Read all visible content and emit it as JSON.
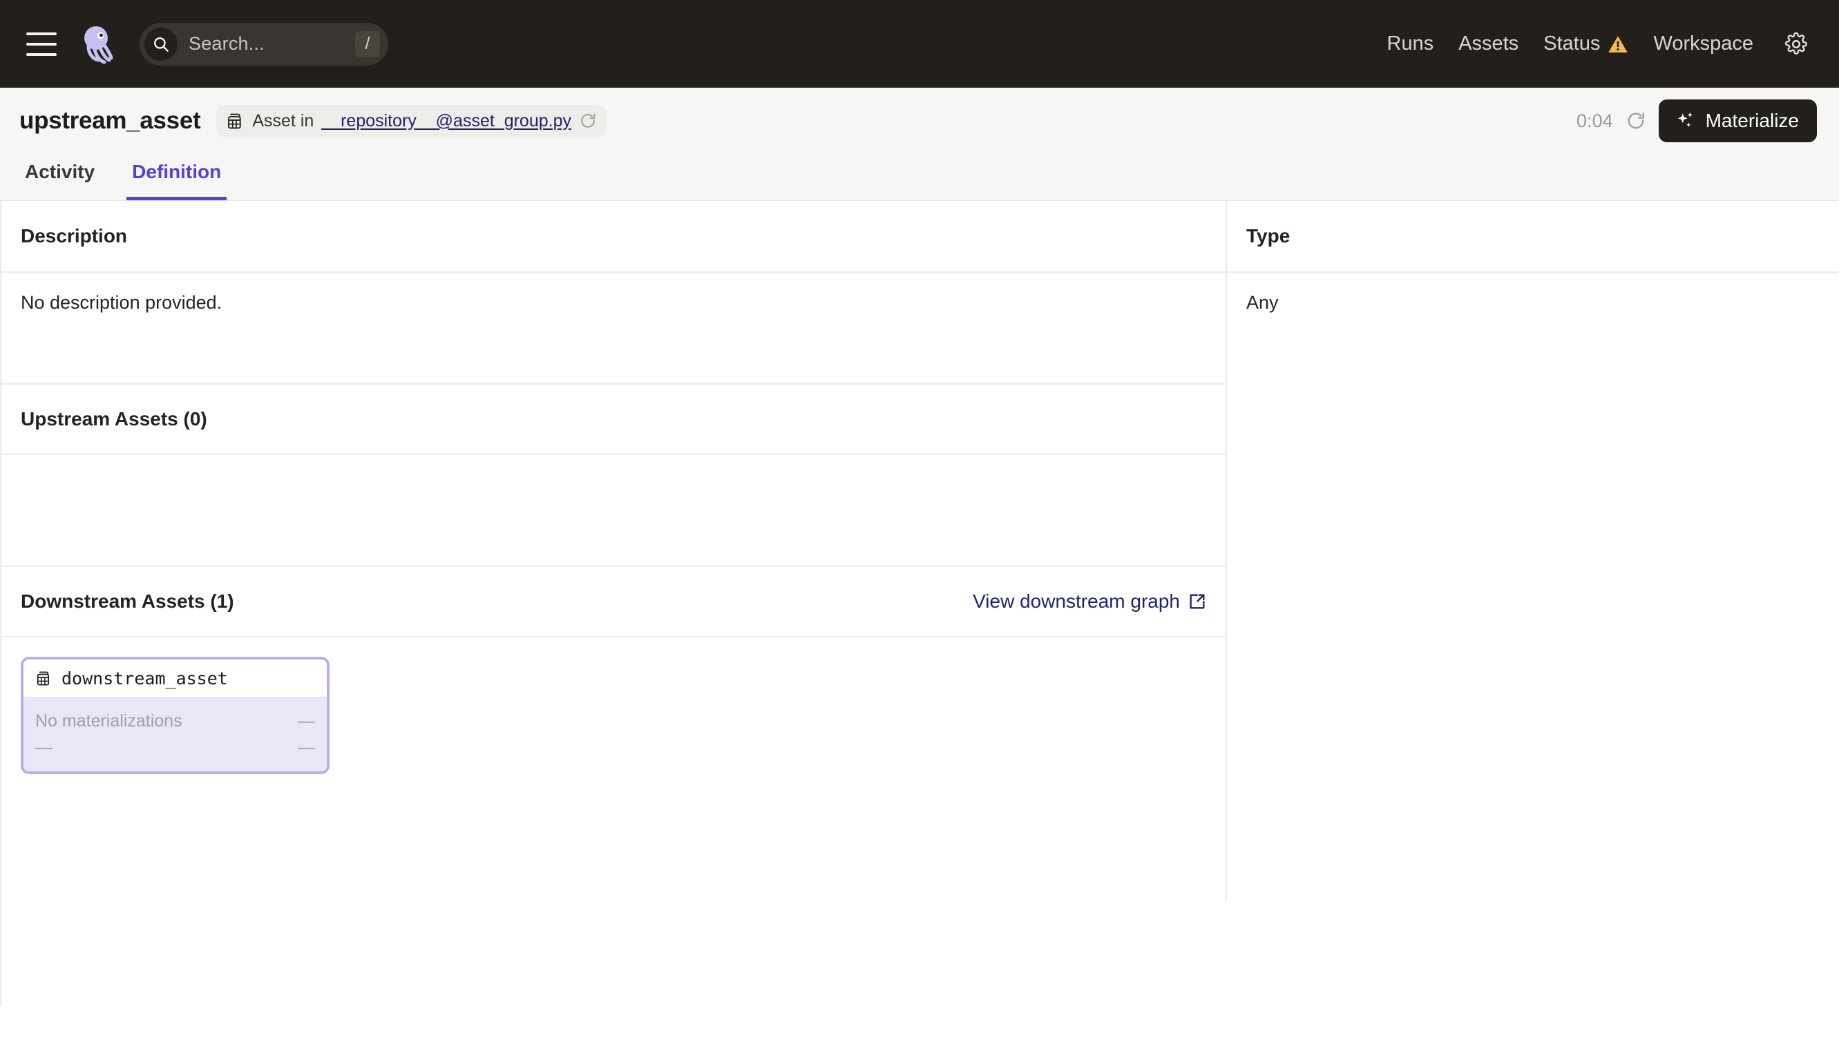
{
  "topnav": {
    "menu_icon": "hamburger-icon",
    "logo_icon": "dagster-logo",
    "search": {
      "placeholder": "Search...",
      "value": "",
      "icon": "search-icon",
      "shortcut": "/"
    },
    "links": [
      {
        "label": "Runs",
        "icon": null
      },
      {
        "label": "Assets",
        "icon": null
      },
      {
        "label": "Status",
        "icon": "warning-triangle-icon"
      },
      {
        "label": "Workspace",
        "icon": null
      }
    ],
    "settings_icon": "gear-icon"
  },
  "header": {
    "title": "upstream_asset",
    "badge": {
      "icon": "asset-table-icon",
      "prefix": "Asset in",
      "link": "__repository__@asset_group.py",
      "refresh_icon": "refresh-icon"
    },
    "timer": "0:04",
    "timer_refresh_icon": "refresh-icon",
    "materialize_label": "Materialize",
    "materialize_icon": "sparkles-icon"
  },
  "tabs": [
    {
      "label": "Activity",
      "active": false
    },
    {
      "label": "Definition",
      "active": true
    }
  ],
  "main": {
    "description": {
      "title": "Description",
      "text": "No description provided."
    },
    "upstream": {
      "title": "Upstream Assets (0)",
      "items": []
    },
    "downstream": {
      "title": "Downstream Assets (1)",
      "link_label": "View downstream graph",
      "link_icon": "external-link-icon",
      "nodes": [
        {
          "icon": "asset-table-icon",
          "name": "downstream_asset",
          "status": "No materializations",
          "status_right": "—",
          "meta_left": "—",
          "meta_right": "—"
        }
      ]
    }
  },
  "sidepanel": {
    "type": {
      "title": "Type",
      "value": "Any"
    }
  },
  "colors": {
    "accent_purple": "#4F43DD",
    "link_navy": "#21226E",
    "nav_bg": "#231F1B",
    "warning_amber": "#F5B852",
    "node_border": "#B7B0F0",
    "node_body": "#E9E7F7"
  }
}
